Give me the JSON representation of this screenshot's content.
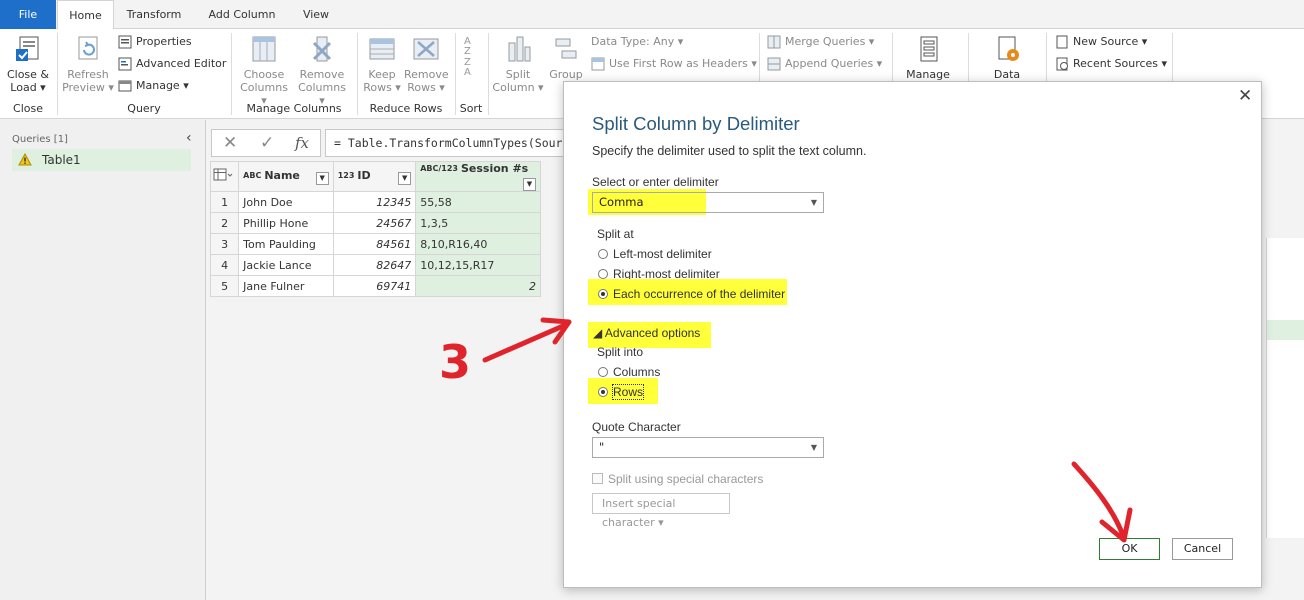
{
  "tabs": {
    "file": "File",
    "home": "Home",
    "transform": "Transform",
    "add_column": "Add Column",
    "view": "View"
  },
  "ribbon": {
    "close_load": [
      "Close &",
      "Load ▾"
    ],
    "refresh_preview": [
      "Refresh",
      "Preview ▾"
    ],
    "properties": "Properties",
    "advanced_editor": "Advanced Editor",
    "manage": "Manage ▾",
    "choose_columns": [
      "Choose",
      "Columns ▾"
    ],
    "remove_columns": [
      "Remove",
      "Columns ▾"
    ],
    "keep_rows": [
      "Keep",
      "Rows ▾"
    ],
    "remove_rows": [
      "Remove",
      "Rows ▾"
    ],
    "split_column": [
      "Split",
      "Column ▾"
    ],
    "group_by": "Group",
    "data_type": "Data Type: Any ▾",
    "use_first_row": "Use First Row as Headers ▾",
    "merge_queries": "Merge Queries ▾",
    "append_queries": "Append Queries ▾",
    "manage_params": "Manage",
    "data_source": "Data source",
    "new_source": "New Source ▾",
    "recent_sources": "Recent Sources ▾",
    "groups": {
      "close": "Close",
      "query": "Query",
      "manage_columns": "Manage Columns",
      "reduce_rows": "Reduce Rows",
      "sort": "Sort"
    }
  },
  "left_pane": {
    "title": "Queries [1]",
    "query_name": "Table1"
  },
  "formula_bar": {
    "cancel": "✕",
    "commit": "✓",
    "fx": "fx",
    "formula": "= Table.TransformColumnTypes(Source"
  },
  "grid": {
    "columns": [
      {
        "type_icon": "ABC",
        "name": "Name"
      },
      {
        "type_icon": "123",
        "name": "ID"
      },
      {
        "type_icon": "ABC/123",
        "name": "Session #s"
      }
    ],
    "rows": [
      {
        "n": "1",
        "name": "John Doe",
        "id": "12345",
        "sessions": "55,58"
      },
      {
        "n": "2",
        "name": "Phillip Hone",
        "id": "24567",
        "sessions": "1,3,5"
      },
      {
        "n": "3",
        "name": "Tom Paulding",
        "id": "84561",
        "sessions": "8,10,R16,40"
      },
      {
        "n": "4",
        "name": "Jackie Lance",
        "id": "82647",
        "sessions": "10,12,15,R17"
      },
      {
        "n": "5",
        "name": "Jane Fulner",
        "id": "69741",
        "sessions": "2"
      }
    ]
  },
  "dialog": {
    "title": "Split Column by Delimiter",
    "subtitle": "Specify the delimiter used to split the text column.",
    "delimiter_label": "Select or enter delimiter",
    "delimiter_value": "Comma",
    "split_at_label": "Split at",
    "split_at_options": [
      "Left-most delimiter",
      "Right-most delimiter",
      "Each occurrence of the delimiter"
    ],
    "split_at_selected": 2,
    "advanced_toggle": "◢ Advanced options",
    "split_into_label": "Split into",
    "split_into_options": [
      "Columns",
      "Rows"
    ],
    "split_into_selected": 1,
    "quote_label": "Quote Character",
    "quote_value": "\"",
    "special_chars_label": "Split using special characters",
    "insert_special": "Insert special character ▾",
    "ok": "OK",
    "cancel": "Cancel"
  },
  "annotations": {
    "step_number": "3",
    "highlight_color": "#ffff3a",
    "arrow_color": "#e0242c"
  },
  "colors": {
    "file_tab": "#1e6fc9",
    "title_text": "#2a5a7c",
    "selected_row_green": "#dff0e0"
  }
}
